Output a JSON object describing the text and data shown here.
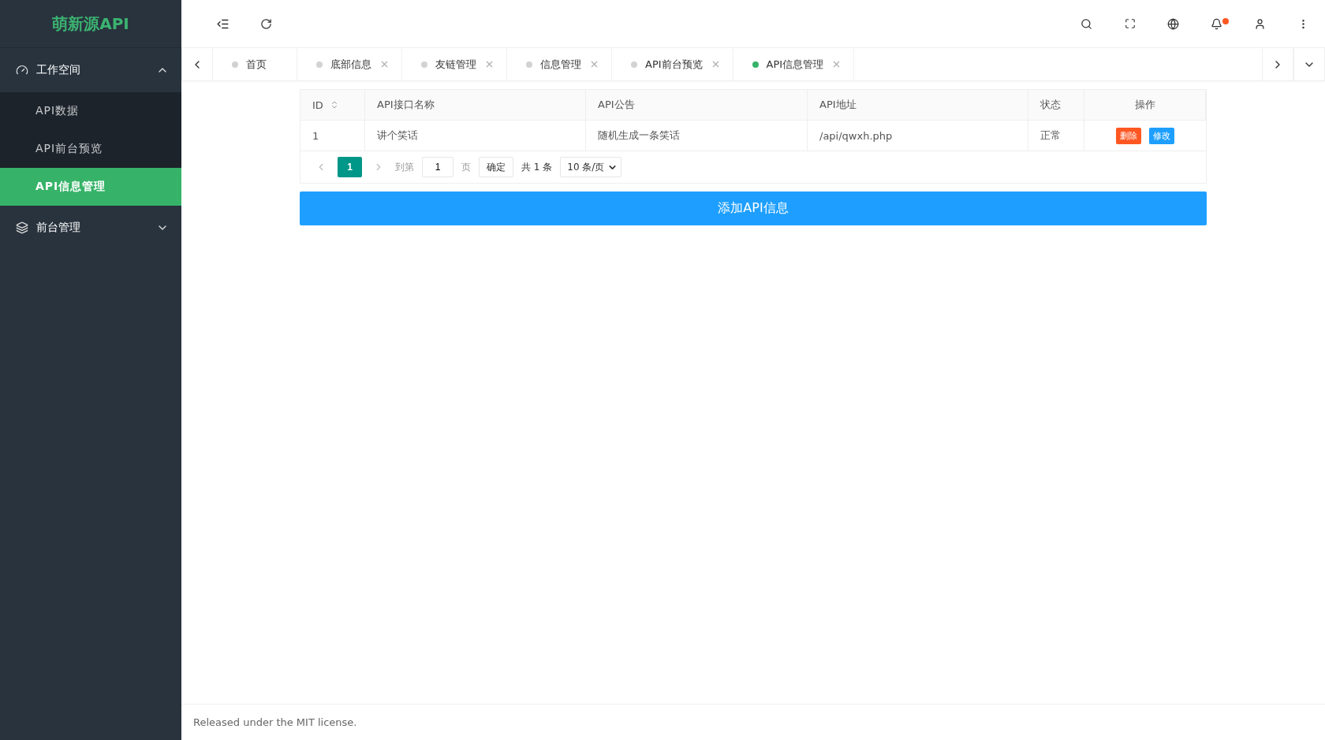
{
  "sidebar": {
    "logo": "萌新源API",
    "groups": [
      {
        "label": "工作空间",
        "expanded": true,
        "children": [
          {
            "label": "API数据",
            "selected": false
          },
          {
            "label": "API前台预览",
            "selected": false
          },
          {
            "label": "API信息管理",
            "selected": true
          }
        ]
      },
      {
        "label": "前台管理",
        "expanded": false
      }
    ]
  },
  "header": {
    "notification_dot": true
  },
  "tabs": [
    {
      "label": "首页",
      "closable": false,
      "selected": false
    },
    {
      "label": "底部信息",
      "closable": true,
      "selected": false
    },
    {
      "label": "友链管理",
      "closable": true,
      "selected": false
    },
    {
      "label": "信息管理",
      "closable": true,
      "selected": false
    },
    {
      "label": "API前台预览",
      "closable": true,
      "selected": false
    },
    {
      "label": "API信息管理",
      "closable": true,
      "selected": true
    }
  ],
  "table": {
    "columns": [
      {
        "label": "ID",
        "sortable": true
      },
      {
        "label": "API接口名称",
        "sortable": false
      },
      {
        "label": "API公告",
        "sortable": false
      },
      {
        "label": "API地址",
        "sortable": false
      },
      {
        "label": "状态",
        "sortable": false
      },
      {
        "label": "操作",
        "sortable": false
      }
    ],
    "rows": [
      {
        "cells": [
          "1",
          "讲个笑话",
          "随机生成一条笑话",
          "/api/qwxh.php",
          "正常"
        ],
        "actions": [
          {
            "label": "删除",
            "kind": "danger"
          },
          {
            "label": "修改",
            "kind": "primary"
          }
        ]
      }
    ]
  },
  "pagination": {
    "current": "1",
    "goto_label": "到第",
    "goto_value": "1",
    "page_unit": "页",
    "confirm": "确定",
    "total": "共 1 条",
    "page_size": "10 条/页"
  },
  "add_button": "添加API信息",
  "footer": "Released under the MIT license."
}
